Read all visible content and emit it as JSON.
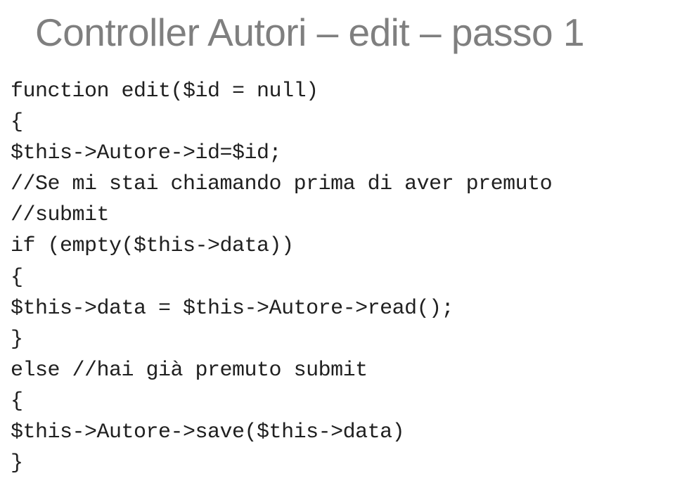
{
  "title": "Controller Autori – edit – passo 1",
  "code": {
    "line1": "function edit($id = null)",
    "line2": "{",
    "line3": "$this->Autore->id=$id;",
    "line4": "//Se mi stai chiamando prima di aver premuto",
    "line5": "//submit",
    "line6": "if (empty($this->data))",
    "line7": "{",
    "line8": "$this->data = $this->Autore->read();",
    "line9": "}",
    "line10": "else //hai già premuto submit",
    "line11": "{",
    "line12": "$this->Autore->save($this->data)",
    "line13": "}"
  }
}
